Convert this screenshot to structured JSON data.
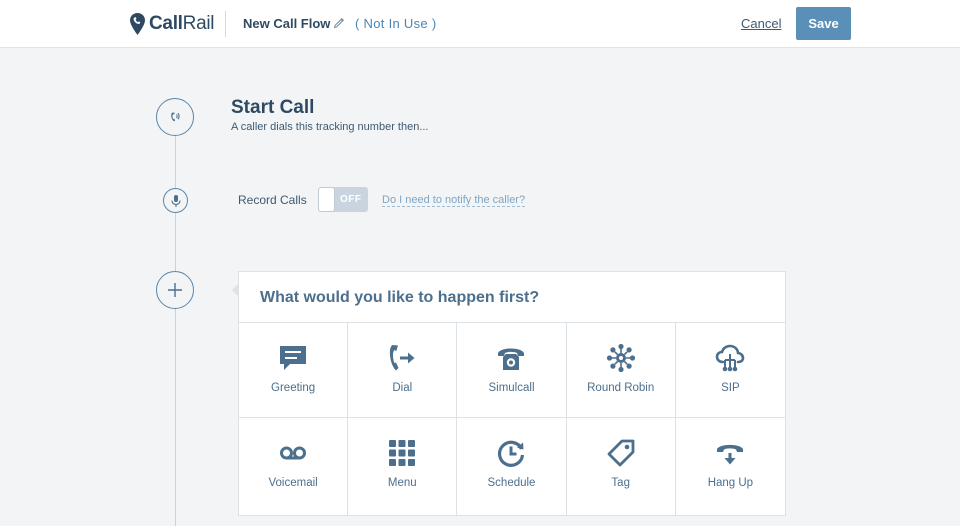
{
  "header": {
    "logo_bold": "Call",
    "logo_light": "Rail",
    "flow_name": "New Call Flow",
    "status": "( Not In Use )",
    "cancel_label": "Cancel",
    "save_label": "Save"
  },
  "flow": {
    "start_title": "Start Call",
    "start_subtitle": "A caller dials this tracking number then...",
    "record_label": "Record Calls",
    "record_toggle": "OFF",
    "notify_link": "Do I need to notify the caller?"
  },
  "panel": {
    "title": "What would you like to happen first?",
    "options": [
      {
        "label": "Greeting",
        "icon": "greeting-icon"
      },
      {
        "label": "Dial",
        "icon": "dial-icon"
      },
      {
        "label": "Simulcall",
        "icon": "simulcall-icon"
      },
      {
        "label": "Round Robin",
        "icon": "round-robin-icon"
      },
      {
        "label": "SIP",
        "icon": "sip-icon"
      },
      {
        "label": "Voicemail",
        "icon": "voicemail-icon"
      },
      {
        "label": "Menu",
        "icon": "menu-icon"
      },
      {
        "label": "Schedule",
        "icon": "schedule-icon"
      },
      {
        "label": "Tag",
        "icon": "tag-icon"
      },
      {
        "label": "Hang Up",
        "icon": "hang-up-icon"
      }
    ]
  },
  "colors": {
    "accent": "#5a8fb7",
    "heading": "#2e4a63",
    "icon": "#4c6f8d",
    "background": "#f3f4f5"
  }
}
